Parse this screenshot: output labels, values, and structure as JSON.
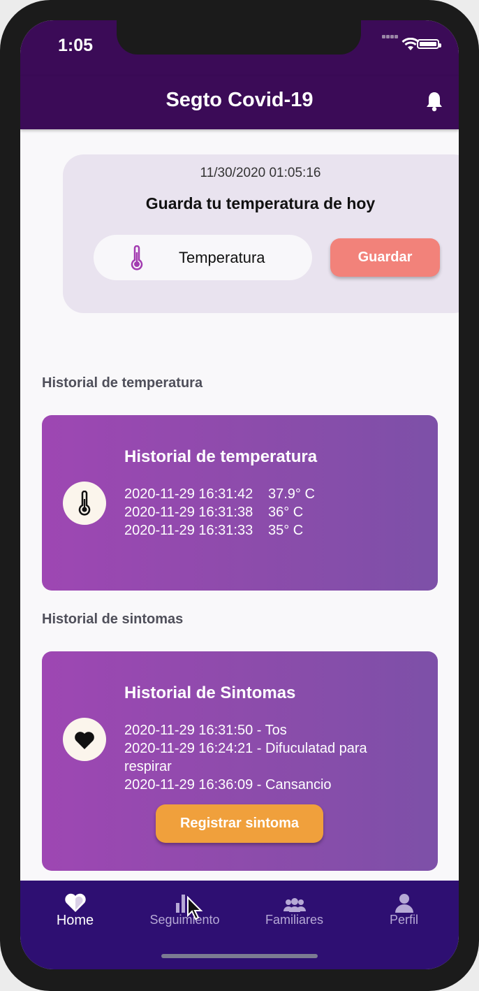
{
  "status_bar": {
    "time": "1:05"
  },
  "app_bar": {
    "title": "Segto Covid-19"
  },
  "temperature_entry": {
    "datetime": "11/30/2020 01:05:16",
    "heading": "Guarda tu temperatura de hoy",
    "input_placeholder": "Temperatura",
    "save_label": "Guardar"
  },
  "temperature_history": {
    "section_label": "Historial de temperatura",
    "card_title": "Historial de temperatura",
    "entries": [
      {
        "date": "2020-11-29 16:31:42",
        "value": "37.9° C"
      },
      {
        "date": "2020-11-29 16:31:38",
        "value": "36° C"
      },
      {
        "date": "2020-11-29 16:31:33",
        "value": "35° C"
      }
    ]
  },
  "symptom_history": {
    "section_label": "Historial de sintomas",
    "card_title": "Historial de Sintomas",
    "entries": [
      "2020-11-29 16:31:50 - Tos",
      "2020-11-29 16:24:21 - Difuculatad para respirar",
      "2020-11-29 16:36:09 - Cansancio"
    ],
    "register_label": "Registrar sintoma"
  },
  "tab_bar": {
    "items": [
      {
        "label": "Home",
        "icon": "heart-icon",
        "active": true
      },
      {
        "label": "Seguimiento",
        "icon": "bar-chart-icon",
        "active": false
      },
      {
        "label": "Familiares",
        "icon": "people-icon",
        "active": false
      },
      {
        "label": "Perfil",
        "icon": "person-icon",
        "active": false
      }
    ]
  },
  "colors": {
    "header": "#3b0b57",
    "tab_bar": "#2e0f72",
    "save_button": "#f2827a",
    "register_button": "#f0a03c",
    "card_gradient_start": "#9e47b3",
    "card_gradient_end": "#7d50a8"
  }
}
